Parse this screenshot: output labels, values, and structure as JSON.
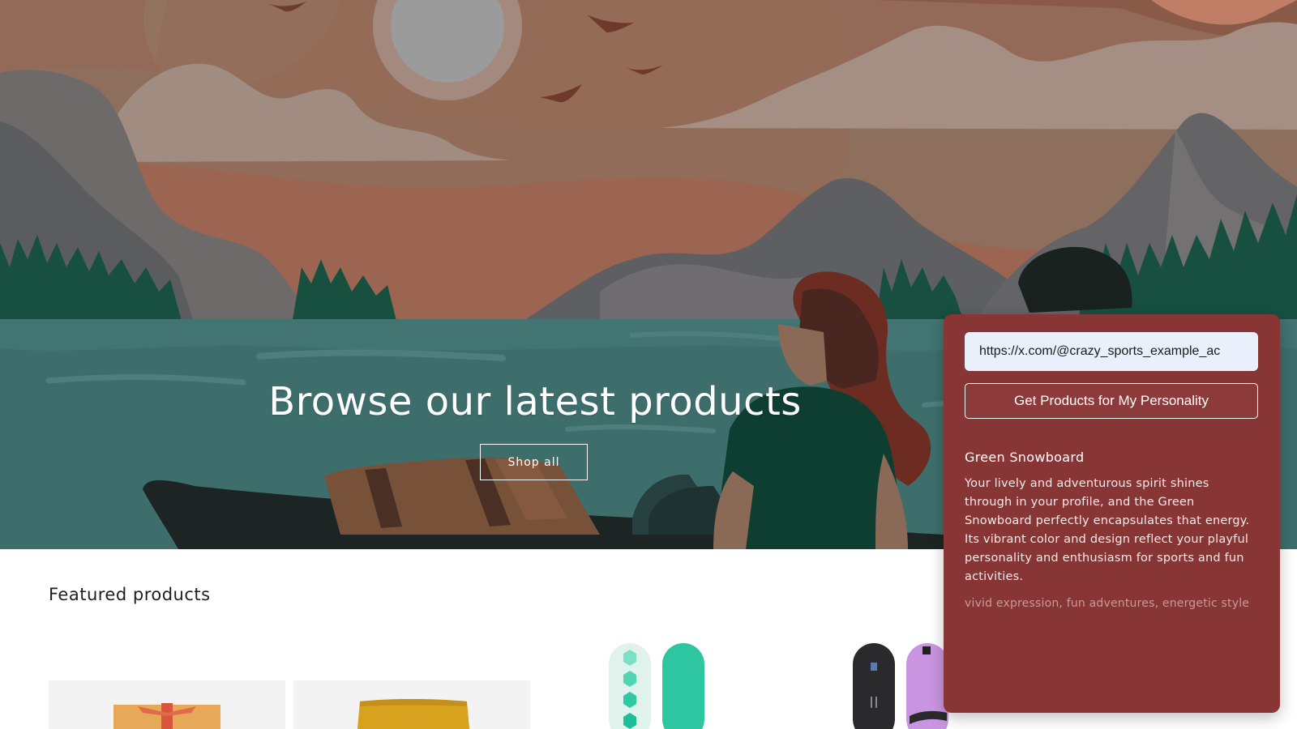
{
  "hero": {
    "title": "Browse our latest products",
    "shop_all_label": "Shop all"
  },
  "featured": {
    "title": "Featured products",
    "products": [
      {
        "image": "gift-box-card-image"
      },
      {
        "image": "wax-bar-card-image"
      },
      {
        "image": "green-snowboard-image"
      },
      {
        "image": "black-purple-snowboard-image"
      }
    ]
  },
  "personality_panel": {
    "url_value": "https://x.com/@crazy_sports_example_ac",
    "button_label": "Get Products for My Personality",
    "product_name": "Green Snowboard",
    "description": "Your lively and adventurous spirit shines through in your profile, and the Green Snowboard perfectly encapsulates that energy. Its vibrant color and design reflect your playful personality and enthusiasm for sports and fun activities.",
    "tags": "vivid expression, fun adventures, energetic style"
  },
  "colors": {
    "panel_bg": "#873535",
    "lake": "#3e6e6c",
    "sky": "#8e6e5c"
  }
}
